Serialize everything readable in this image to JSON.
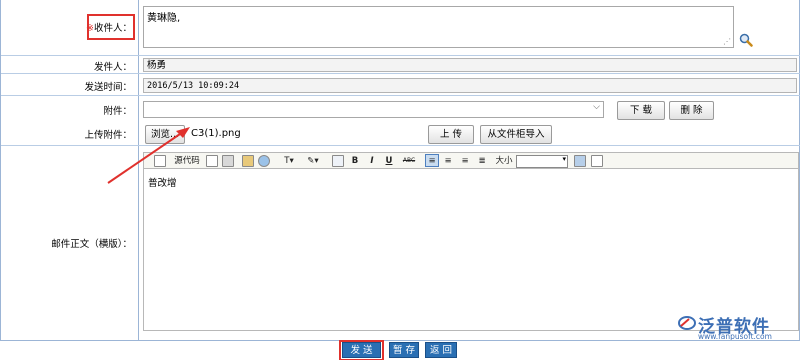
{
  "form": {
    "recipients": {
      "required_mark": "※",
      "label": "收件人：",
      "value": "黄琳隐,"
    },
    "sender": {
      "label": "发件人：",
      "value": "杨勇"
    },
    "send_time": {
      "label": "发送时间：",
      "value": "2016/5/13 10:09:24"
    },
    "attachment": {
      "label": "附件：",
      "download_label": "下 载",
      "delete_label": "删 除"
    },
    "upload": {
      "label": "上传附件：",
      "browse_label": "浏览...",
      "file_name": "C3(1).png",
      "upload_label": "上 传",
      "import_label": "从文件柜导入"
    },
    "body": {
      "label": "邮件正文（横版）：",
      "content": "普改增"
    }
  },
  "toolbar": {
    "source_label": "源代码",
    "bold_label": "B",
    "italic_label": "I",
    "underline_label": "U",
    "strike_label": "ABC",
    "size_label": "大小"
  },
  "actions": {
    "send_label": "发 送",
    "save_label": "暂 存",
    "back_label": "返 回"
  },
  "watermark": {
    "brand": "泛普软件",
    "url": "www.fanpusoft.com"
  },
  "colors": {
    "accent_blue": "#2a6fb3",
    "highlight_red": "#e0312d",
    "border_blue": "#9cb5d6"
  }
}
